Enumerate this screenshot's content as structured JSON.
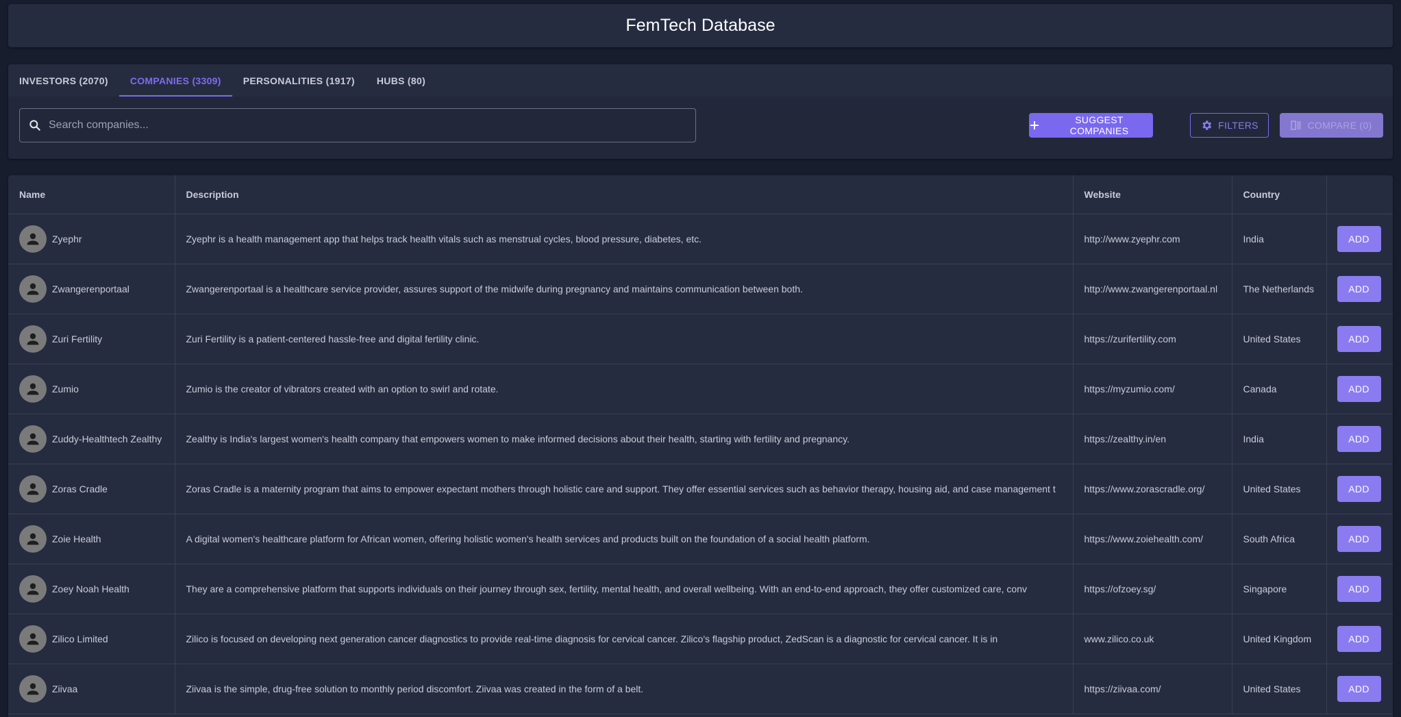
{
  "app": {
    "title": "FemTech Database"
  },
  "tabs": [
    {
      "label": "INVESTORS (2070)",
      "active": false
    },
    {
      "label": "COMPANIES (3309)",
      "active": true
    },
    {
      "label": "PERSONALITIES (1917)",
      "active": false
    },
    {
      "label": "HUBS (80)",
      "active": false
    }
  ],
  "search": {
    "placeholder": "Search companies...",
    "value": ""
  },
  "toolbar": {
    "suggest_label": "SUGGEST COMPANIES",
    "filters_label": "FILTERS",
    "compare_label": "COMPARE (0)"
  },
  "colors": {
    "accent": "#7a68ef",
    "background": "#181d2e",
    "surface": "#262c40"
  },
  "table": {
    "columns": [
      "Name",
      "Description",
      "Website",
      "Country",
      ""
    ],
    "add_label": "ADD",
    "rows": [
      {
        "name": "Zyephr",
        "description": "Zyephr is a health management app that helps track health vitals such as menstrual cycles, blood pressure, diabetes, etc.",
        "website": "http://www.zyephr.com",
        "country": "India"
      },
      {
        "name": "Zwangerenportaal",
        "description": "Zwangerenportaal is a healthcare service provider, assures support of the midwife during pregnancy and maintains communication between both.",
        "website": "http://www.zwangerenportaal.nl",
        "country": "The Netherlands"
      },
      {
        "name": "Zuri Fertility",
        "description": "Zuri Fertility is a patient-centered hassle-free and digital fertility clinic.",
        "website": "https://zurifertility.com",
        "country": "United States"
      },
      {
        "name": "Zumio",
        "description": "Zumio is the creator of vibrators created with an option to swirl and rotate.",
        "website": "https://myzumio.com/",
        "country": "Canada"
      },
      {
        "name": "Zuddy-Healthtech Zealthy",
        "description": "Zealthy is India's largest women's health company that empowers women to make informed decisions about their health, starting with fertility and pregnancy.",
        "website": "https://zealthy.in/en",
        "country": "India"
      },
      {
        "name": "Zoras Cradle",
        "description": "Zoras Cradle is a maternity program that aims to empower expectant mothers through holistic care and support. They offer essential services such as behavior therapy, housing aid, and case management t",
        "website": "https://www.zorascradle.org/",
        "country": "United States"
      },
      {
        "name": "Zoie Health",
        "description": "A digital women's healthcare platform for African women, offering holistic women's health services and products built on the foundation of a social health platform.",
        "website": "https://www.zoiehealth.com/",
        "country": "South Africa"
      },
      {
        "name": "Zoey Noah Health",
        "description": "They are a comprehensive platform that supports individuals on their journey through sex, fertility, mental health, and overall wellbeing. With an end-to-end approach, they offer customized care, conv",
        "website": "https://ofzoey.sg/",
        "country": "Singapore"
      },
      {
        "name": "Zilico Limited",
        "description": "Zilico is focused on developing next generation cancer diagnostics to provide real-time diagnosis for cervical cancer. Zilico's flagship product, ZedScan is a diagnostic for cervical cancer. It is in",
        "website": "www.zilico.co.uk",
        "country": "United Kingdom"
      },
      {
        "name": "Ziivaa",
        "description": "Ziivaa is the simple, drug-free solution to monthly period discomfort. Ziivaa was created in the form of a belt.",
        "website": "https://ziivaa.com/",
        "country": "United States"
      }
    ]
  }
}
